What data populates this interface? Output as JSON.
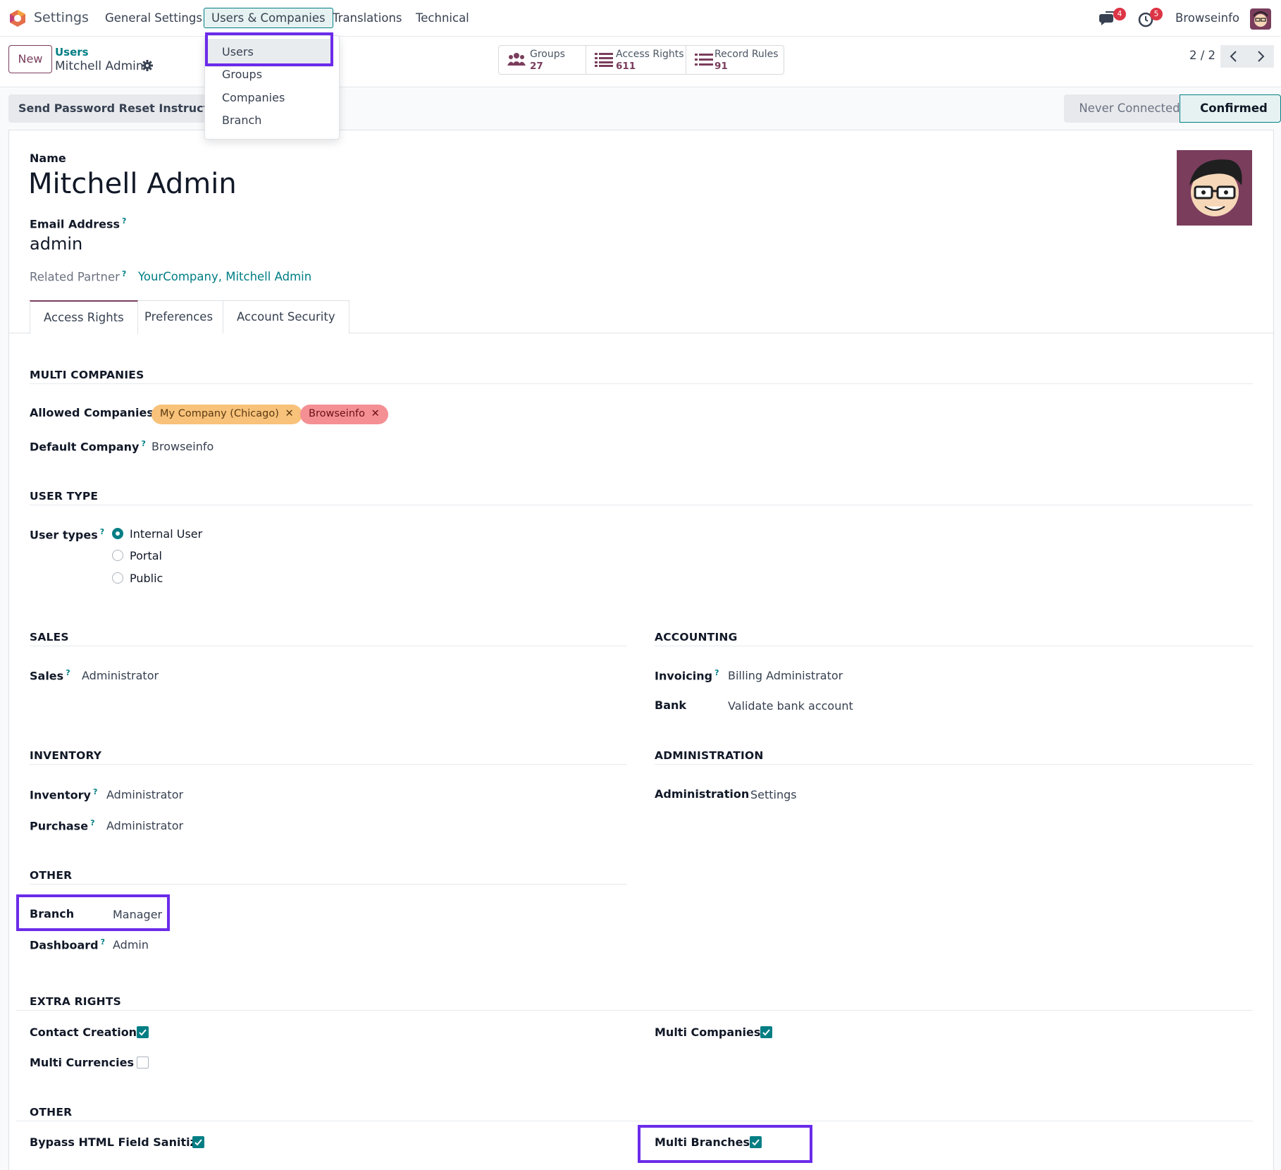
{
  "topbar": {
    "app_name": "Settings",
    "menu": [
      "General Settings",
      "Users & Companies",
      "Translations",
      "Technical"
    ],
    "messages_badge": "4",
    "activities_badge": "5",
    "company": "Browseinfo"
  },
  "dropdown": {
    "items": [
      "Users",
      "Groups",
      "Companies",
      "Branch"
    ]
  },
  "control": {
    "new_label": "New",
    "breadcrumb_parent": "Users",
    "breadcrumb_current": "Mitchell Admin",
    "smart_buttons": [
      {
        "label": "Groups",
        "value": "27"
      },
      {
        "label": "Access Rights",
        "value": "611"
      },
      {
        "label": "Record Rules",
        "value": "91"
      }
    ],
    "pager": "2 / 2"
  },
  "actions": {
    "reset_button": "Send Password Reset Instructions",
    "status_inactive": "Never Connected",
    "status_active": "Confirmed"
  },
  "form": {
    "name_label": "Name",
    "name_value": "Mitchell Admin",
    "email_label": "Email Address",
    "email_value": "admin",
    "partner_label": "Related Partner",
    "partner_value": "YourCompany, Mitchell Admin",
    "tooltip_mark": "?"
  },
  "tabs": [
    "Access Rights",
    "Preferences",
    "Account Security"
  ],
  "multi_companies": {
    "title": "MULTI COMPANIES",
    "allowed_label": "Allowed Companies",
    "allowed_tags": [
      "My Company (Chicago)",
      "Browseinfo"
    ],
    "default_label": "Default Company",
    "default_value": "Browseinfo"
  },
  "user_type": {
    "title": "USER TYPE",
    "label": "User types",
    "options": [
      "Internal User",
      "Portal",
      "Public"
    ],
    "selected": "Internal User"
  },
  "sales": {
    "title": "SALES",
    "label": "Sales",
    "value": "Administrator"
  },
  "accounting": {
    "title": "ACCOUNTING",
    "invoicing_label": "Invoicing",
    "invoicing_value": "Billing Administrator",
    "bank_label": "Bank",
    "bank_value": "Validate bank account"
  },
  "inventory": {
    "title": "INVENTORY",
    "inventory_label": "Inventory",
    "inventory_value": "Administrator",
    "purchase_label": "Purchase",
    "purchase_value": "Administrator"
  },
  "administration": {
    "title": "ADMINISTRATION",
    "label": "Administration",
    "value": "Settings"
  },
  "other": {
    "title": "OTHER",
    "branch_label": "Branch",
    "branch_value": "Manager",
    "dashboard_label": "Dashboard",
    "dashboard_value": "Admin"
  },
  "extra_rights": {
    "title": "EXTRA RIGHTS",
    "contact_creation": "Contact Creation",
    "contact_creation_checked": true,
    "multi_currencies": "Multi Currencies",
    "multi_currencies_checked": false,
    "multi_companies": "Multi Companies",
    "multi_companies_checked": true
  },
  "other2": {
    "title": "OTHER",
    "bypass": "Bypass HTML Field Sanitize",
    "bypass_checked": true,
    "multi_branches": "Multi Branches",
    "multi_branches_checked": true
  },
  "colors": {
    "brand": "#7a3d5c",
    "accent": "#017e84",
    "highlight": "#6b2bea",
    "tag_orange": "#f8c27a",
    "tag_red": "#f48f94"
  }
}
